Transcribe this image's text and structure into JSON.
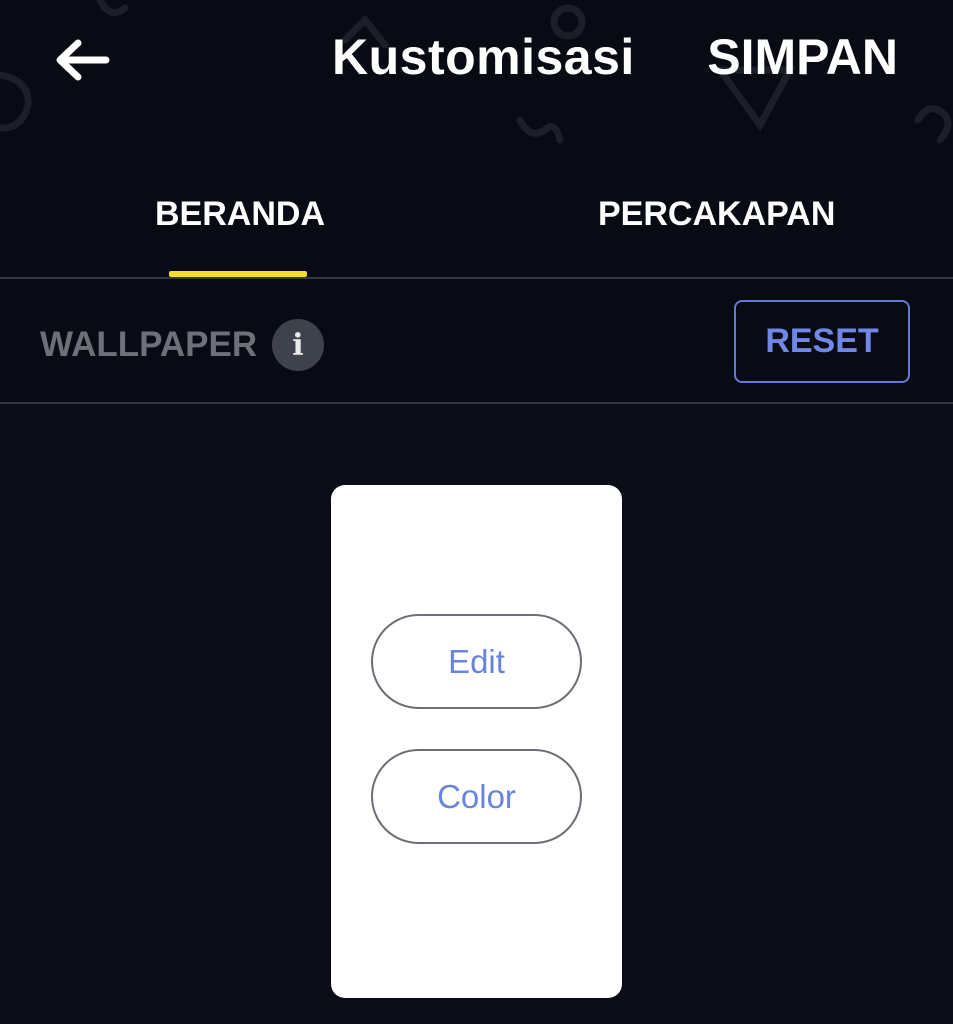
{
  "header": {
    "title": "Kustomisasi",
    "save_label": "SIMPAN",
    "back_icon": "arrow-left-icon"
  },
  "tabs": [
    {
      "label": "BERANDA",
      "active": true
    },
    {
      "label": "PERCAKAPAN",
      "active": false
    }
  ],
  "wallpaper": {
    "label": "WALLPAPER",
    "info_icon": "i",
    "reset_label": "RESET"
  },
  "preview": {
    "edit_label": "Edit",
    "color_label": "Color"
  },
  "colors": {
    "background": "#080b13",
    "tab_indicator": "#f5dd2c",
    "accent": "#7087e6",
    "muted_text": "#6d7079"
  }
}
